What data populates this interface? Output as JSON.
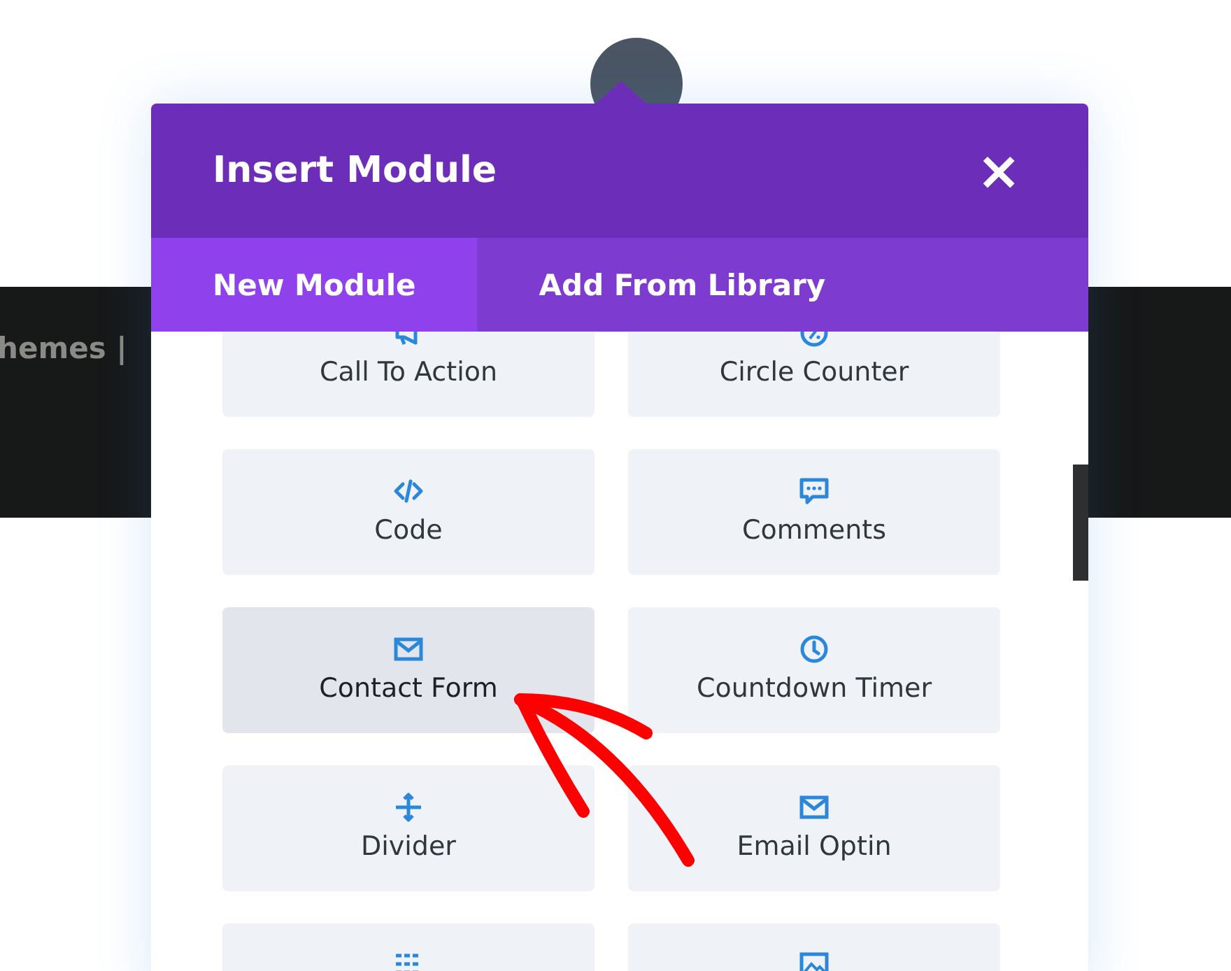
{
  "background": {
    "text": "hemes |"
  },
  "dialog": {
    "title": "Insert Module",
    "close": "×",
    "tabs": [
      {
        "label": "New Module",
        "selected": true
      },
      {
        "label": "Add From Library",
        "selected": false
      }
    ],
    "modules": [
      {
        "label": "Call To Action",
        "selected": false
      },
      {
        "label": "Circle Counter",
        "selected": false
      },
      {
        "label": "Code",
        "selected": false
      },
      {
        "label": "Comments",
        "selected": false
      },
      {
        "label": "Contact Form",
        "selected": true
      },
      {
        "label": "Countdown Timer",
        "selected": false
      },
      {
        "label": "Divider",
        "selected": false
      },
      {
        "label": "Email Optin",
        "selected": false
      },
      {
        "selected": false
      },
      {
        "selected": false
      }
    ]
  }
}
